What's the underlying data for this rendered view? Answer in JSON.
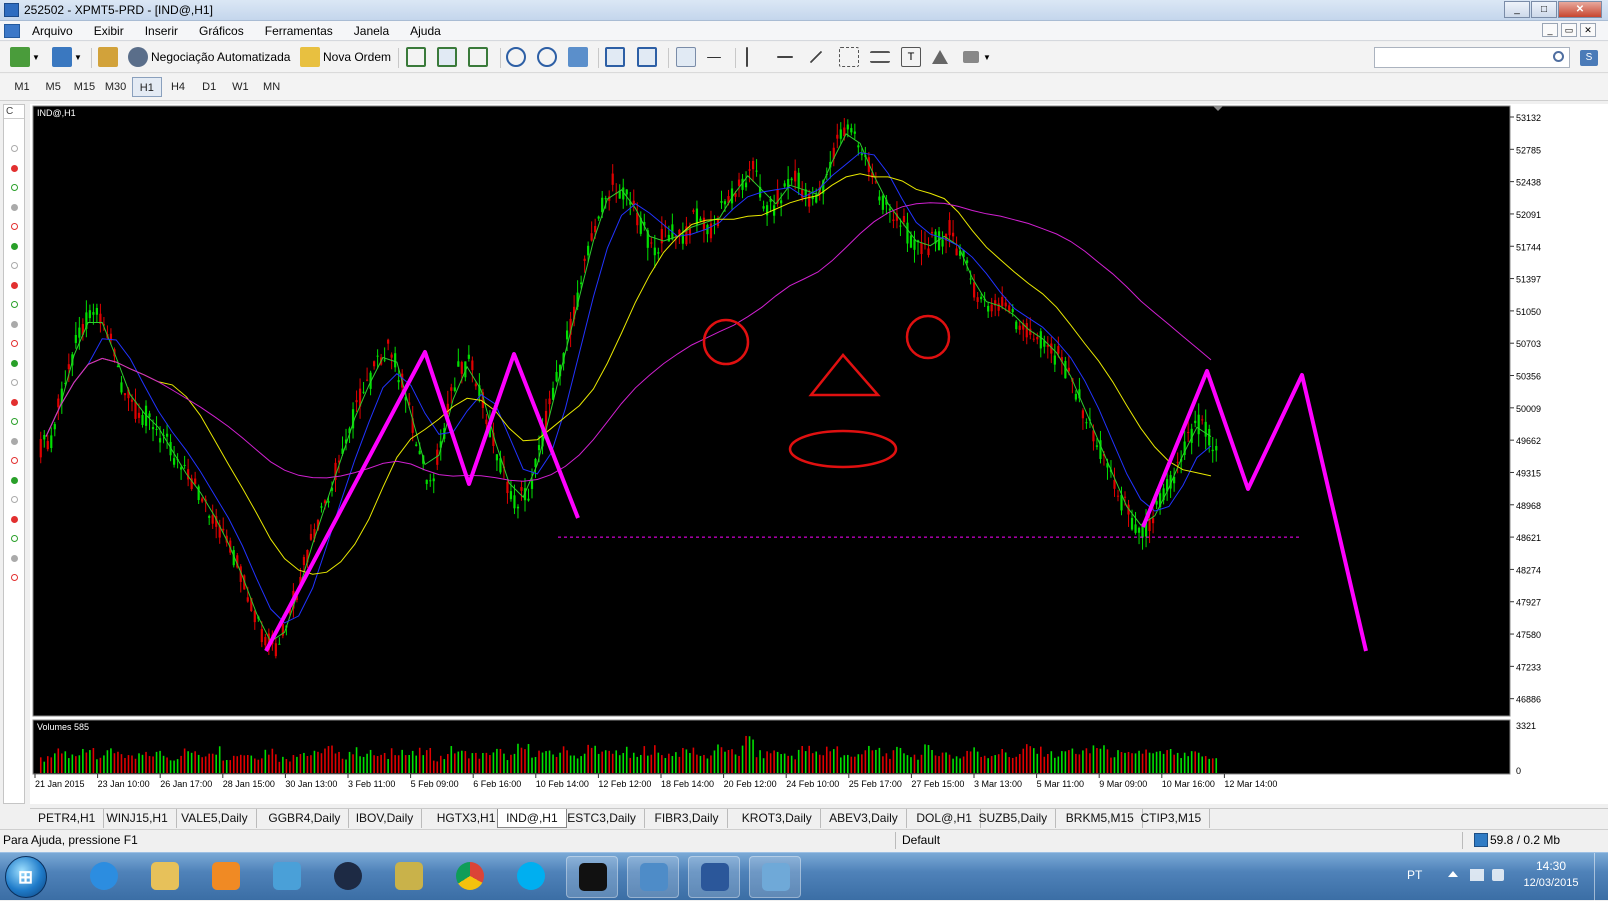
{
  "window": {
    "title": "252502 - XPMT5-PRD - [IND@,H1]"
  },
  "menu": {
    "items": [
      "Arquivo",
      "Exibir",
      "Inserir",
      "Gráficos",
      "Ferramentas",
      "Janela",
      "Ajuda"
    ]
  },
  "toolbar": {
    "auto_trading_label": "Negociação Automatizada",
    "new_order_label": "Nova Ordem",
    "search_placeholder": ""
  },
  "timeframes": [
    "M1",
    "M5",
    "M15",
    "M30",
    "H1",
    "H4",
    "D1",
    "W1",
    "MN"
  ],
  "active_timeframe": "H1",
  "left_panel": {
    "header": "C"
  },
  "chart": {
    "label": "IND@,H1",
    "volume_label": "Volumes 585",
    "price_ticks": [
      "53132",
      "52785",
      "52438",
      "52091",
      "51744",
      "51397",
      "51050",
      "50703",
      "50356",
      "50009",
      "49662",
      "49315",
      "48968",
      "48621",
      "48274",
      "47927",
      "47580",
      "47233",
      "46886"
    ],
    "volume_ticks": [
      "3321",
      "0"
    ],
    "date_ticks": [
      "21 Jan 2015",
      "23 Jan 10:00",
      "26 Jan 17:00",
      "28 Jan 15:00",
      "30 Jan 13:00",
      "3 Feb 11:00",
      "5 Feb 09:00",
      "6 Feb 16:00",
      "10 Feb 14:00",
      "12 Feb 12:00",
      "18 Feb 14:00",
      "20 Feb 12:00",
      "24 Feb 10:00",
      "25 Feb 17:00",
      "27 Feb 15:00",
      "3 Mar 13:00",
      "5 Mar 11:00",
      "9 Mar 09:00",
      "10 Mar 16:00",
      "12 Mar 14:00"
    ],
    "colors": {
      "background": "#000000",
      "bull": "#00e000",
      "bear": "#e00000",
      "ma_fast": "#2ecc2e",
      "ma_mid": "#2233ff",
      "ma_slow": "#e8e800",
      "ma_long": "#d020d0",
      "drawing": "#ff00ff",
      "shapes": "#e01010"
    }
  },
  "chart_data": {
    "type": "candlestick",
    "symbol": "IND@",
    "timeframe": "H1",
    "y_axis_ticks": [
      53132,
      52785,
      52438,
      52091,
      51744,
      51397,
      51050,
      50703,
      50356,
      50009,
      49662,
      49315,
      48968,
      48621,
      48274,
      47927,
      47580,
      47233,
      46886
    ],
    "ylim": [
      46700,
      53250
    ],
    "support_level": 48621,
    "series": [
      {
        "values": [
          49700,
          50350,
          50800,
          51050,
          50800,
          50300,
          50000,
          49900,
          49700,
          49400,
          49200,
          49000,
          48700,
          48400,
          48000,
          47600,
          47400,
          47800,
          48300,
          48800,
          49200,
          49700,
          50100,
          50400,
          50700,
          50300,
          49600,
          49200,
          49800,
          50400,
          50500,
          49900,
          49400,
          49000,
          49100,
          49700,
          50300,
          50900,
          51500,
          52100,
          52400,
          52300,
          52000,
          51700,
          51900,
          51800,
          52100,
          51900,
          52200,
          52400,
          52600,
          52100,
          52300,
          52500,
          52200,
          52400,
          52900,
          53000,
          52700,
          52300,
          52100,
          51900,
          51700,
          51800,
          51900,
          51600,
          51200,
          51100,
          51100,
          50900,
          50800,
          50700,
          50500,
          50200,
          49800,
          49500,
          49100,
          48800,
          48700,
          49000,
          49300,
          49700,
          49900,
          49500
        ]
      },
      {
        "name": "Volumes",
        "values": [
          1400,
          2100,
          1700,
          2600,
          1900,
          2300,
          1500,
          1800,
          2000,
          1600,
          2200,
          1900,
          2400,
          1700,
          2000,
          1800,
          2300,
          1500,
          2100,
          1900,
          2500,
          1800,
          2200,
          2000,
          1700,
          2400,
          1900,
          2100,
          1600,
          2300,
          2000,
          1800,
          2200,
          1700,
          2500,
          2100,
          1900,
          2300,
          1800,
          2600,
          2000,
          2200,
          1700,
          2400,
          1900,
          2100,
          2300,
          1800,
          2500,
          2000,
          3321,
          1900,
          2200,
          1800,
          2400,
          2000,
          2600,
          1700,
          2100,
          2300,
          1900,
          2200,
          1800,
          2400,
          2000,
          1700,
          2300,
          1900,
          2100,
          1800,
          2500,
          2200,
          1900,
          2300,
          2100,
          2700,
          2000,
          1800,
          2200,
          1900,
          2100,
          1700,
          1900,
          1500
        ]
      }
    ]
  },
  "symbol_tabs": [
    "PETR4,H1",
    "WINJ15,H1",
    "VALE5,Daily",
    "GGBR4,Daily",
    "IBOV,Daily",
    "HGTX3,H1",
    "IND@,H1",
    "ESTC3,Daily",
    "FIBR3,Daily",
    "KROT3,Daily",
    "ABEV3,Daily",
    "DOL@,H1",
    "SUZB5,Daily",
    "BRKM5,M15",
    "CTIP3,M15"
  ],
  "active_tab": "IND@,H1",
  "status": {
    "help_text": "Para Ajuda, pressione F1",
    "profile": "Default",
    "traffic": "59.8 / 0.2 Mb"
  },
  "taskbar": {
    "start_glyph": "⊞",
    "language": "PT",
    "time": "14:30",
    "date": "12/03/2015"
  }
}
